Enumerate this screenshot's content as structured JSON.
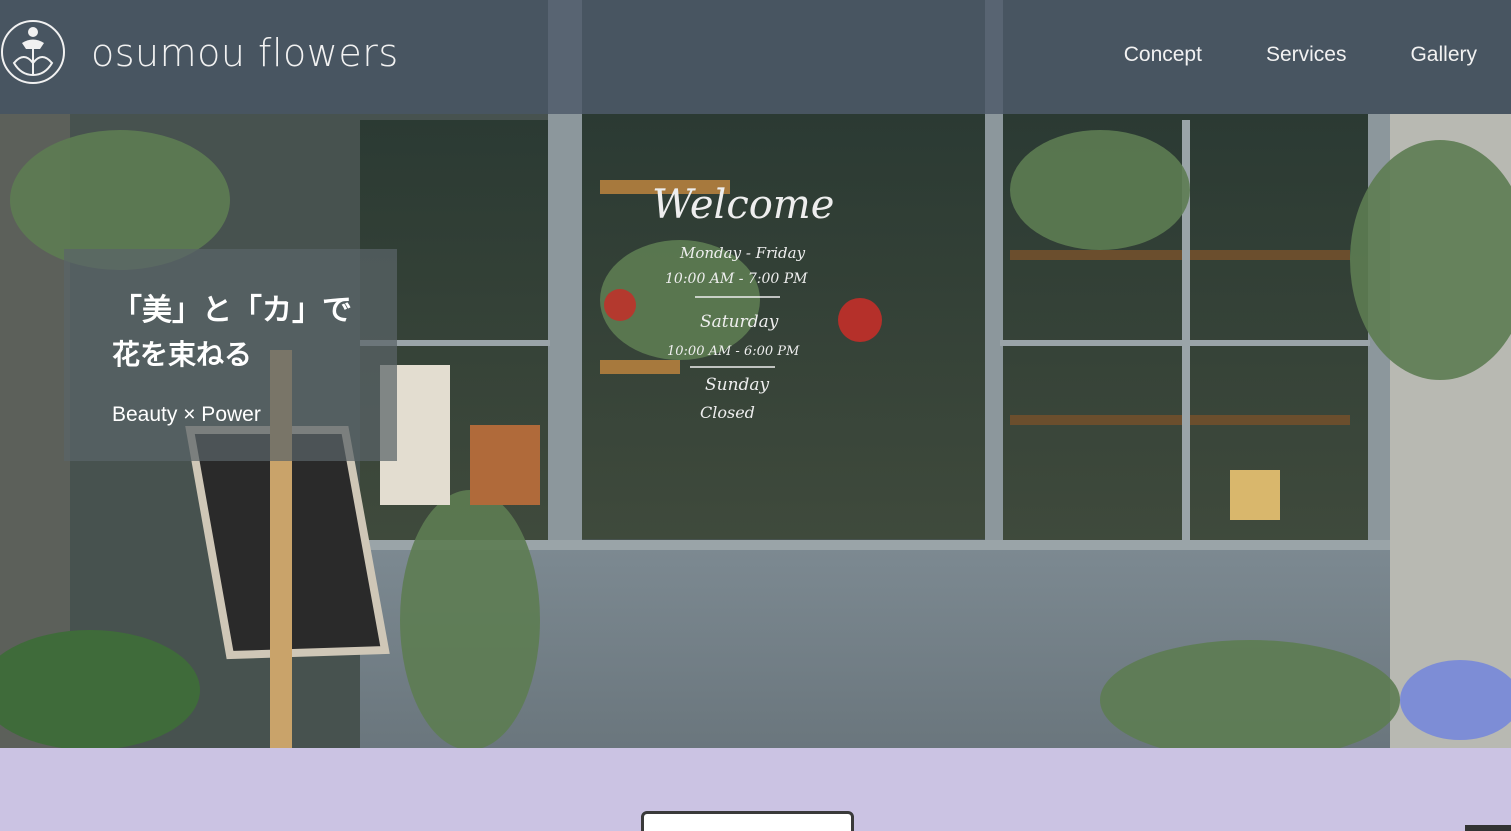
{
  "header": {
    "brand": "osumou flowers",
    "nav": [
      {
        "label": "Concept"
      },
      {
        "label": "Services"
      },
      {
        "label": "Gallery"
      }
    ]
  },
  "hero": {
    "tagline_line1": "「美」と「カ」で",
    "tagline_line2": "花を束ねる",
    "tagline_sub": "Beauty × Power",
    "window_sign": {
      "title": "Welcome",
      "line1": "Monday - Friday",
      "line2": "10:00 AM - 7:00 PM",
      "line3": "Saturday",
      "line4": "10:00 AM - 6:00 PM",
      "line5": "Sunday",
      "line6": "Closed"
    }
  },
  "colors": {
    "header_bg": "#495666",
    "page_bg": "#cbc3e3",
    "tagline_bg": "#5a6468"
  }
}
